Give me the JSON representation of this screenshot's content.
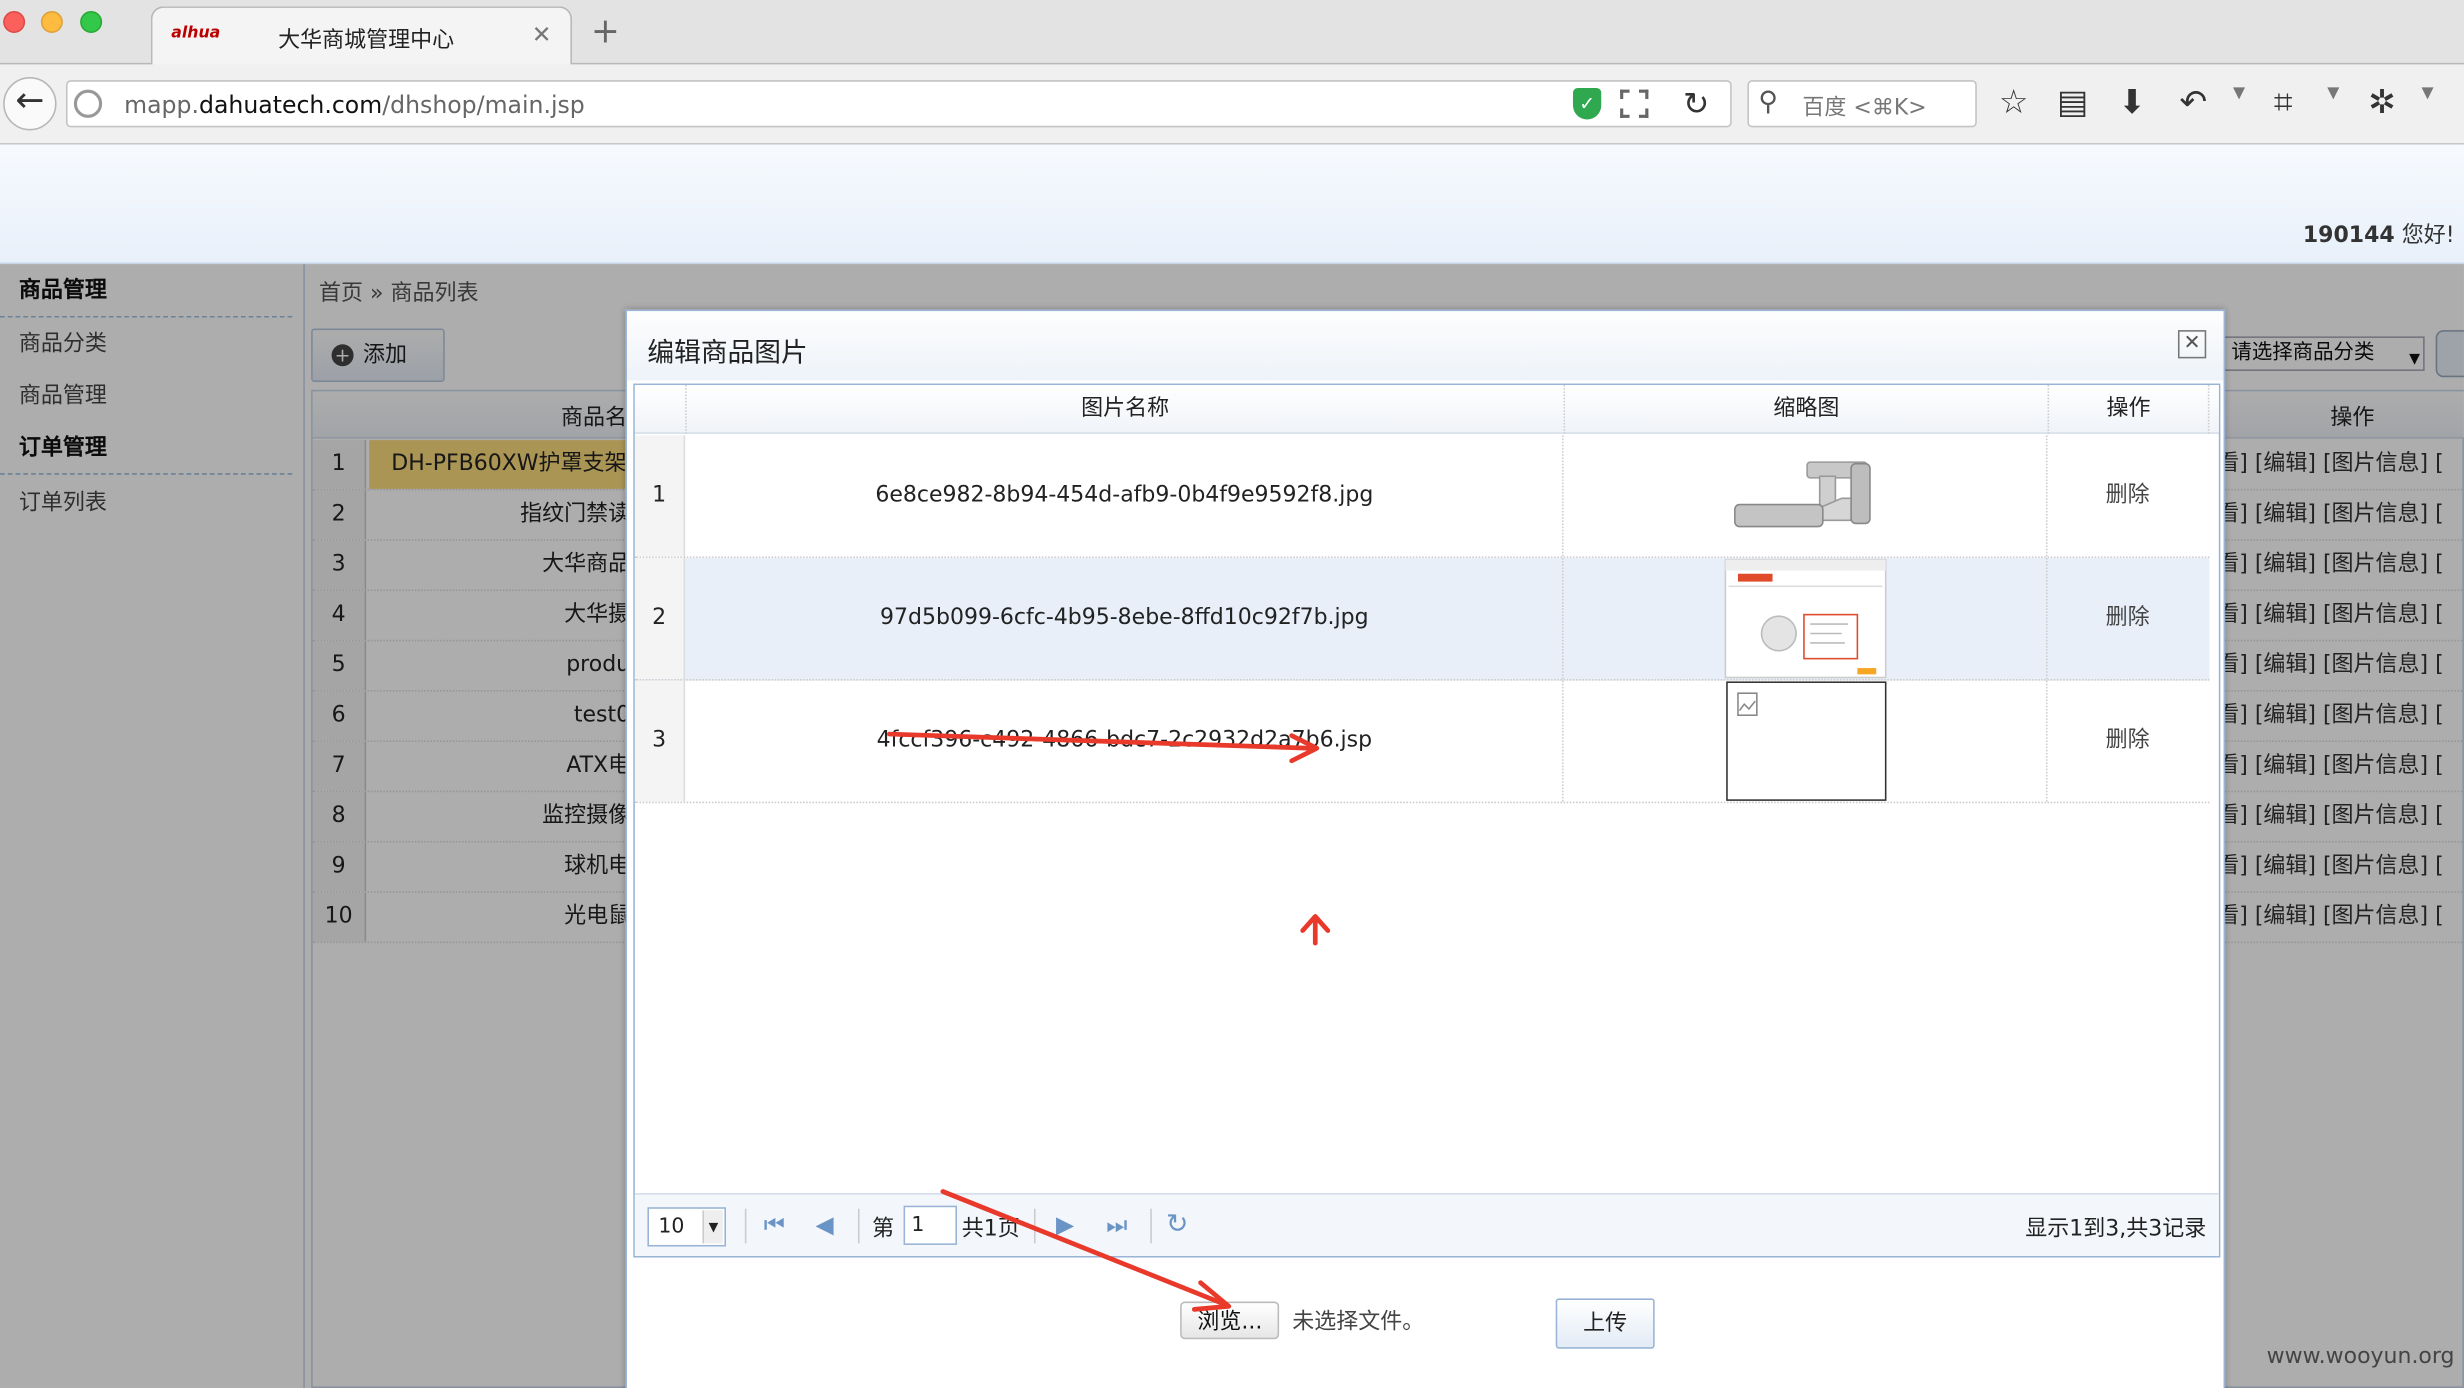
{
  "browser": {
    "tab_title": "大华商城管理中心",
    "tab_logo": "alhua",
    "new_tab": "+",
    "url_prefix": "mapp.",
    "url_domain": "dahuatech.com",
    "url_path": "/dhshop/main.jsp",
    "search_placeholder": "百度 <⌘K>"
  },
  "header": {
    "user": "190144",
    "greeting": " 您好!"
  },
  "sidebar": {
    "items": [
      {
        "label": "商品管理",
        "group": true
      },
      {
        "label": "商品分类",
        "group": false
      },
      {
        "label": "商品管理",
        "group": false
      },
      {
        "label": "订单管理",
        "group": true
      },
      {
        "label": "订单列表",
        "group": false
      }
    ]
  },
  "main": {
    "breadcrumb": "首页 » 商品列表",
    "add_label": "添加",
    "category_select": "请选择商品分类",
    "col_name": "商品名",
    "col_ops": "操作",
    "ops_text": "看] [编辑] [图片信息] [",
    "rows": [
      {
        "num": "1",
        "name": "DH-PFB60XW护罩支架",
        "selected": true
      },
      {
        "num": "2",
        "name": "指纹门禁读"
      },
      {
        "num": "3",
        "name": "大华商品"
      },
      {
        "num": "4",
        "name": "大华摄"
      },
      {
        "num": "5",
        "name": "produ"
      },
      {
        "num": "6",
        "name": "test0"
      },
      {
        "num": "7",
        "name": "ATX电"
      },
      {
        "num": "8",
        "name": "监控摄像"
      },
      {
        "num": "9",
        "name": "球机电"
      },
      {
        "num": "10",
        "name": "光电鼠"
      }
    ]
  },
  "dialog": {
    "title": "编辑商品图片",
    "columns": [
      "图片名称",
      "缩略图",
      "操作"
    ],
    "rows": [
      {
        "num": "1",
        "name": "6e8ce982-8b94-454d-afb9-0b4f9e9592f8.jpg",
        "action": "删除",
        "thumb": "bracket-image"
      },
      {
        "num": "2",
        "name": "97d5b099-6cfc-4b95-8ebe-8ffd10c92f7b.jpg",
        "action": "删除",
        "thumb": "webpage-screenshot"
      },
      {
        "num": "3",
        "name": "4fccf396-c492-4866-bdc7-2c2932d2a7b6.jsp",
        "action": "删除",
        "thumb": "broken-image"
      }
    ],
    "pager": {
      "page_size": "10",
      "page_prefix": "第",
      "page_value": "1",
      "page_total": "共1页",
      "info": "显示1到3,共3记录"
    },
    "browse_label": "浏览...",
    "no_file": "未选择文件。",
    "upload_label": "上传"
  },
  "watermark": "www.wooyun.org",
  "colors": {
    "selected_row": "#fbdc7c",
    "alt_row": "#e8eff9",
    "annotation_red": "#e8392a"
  }
}
